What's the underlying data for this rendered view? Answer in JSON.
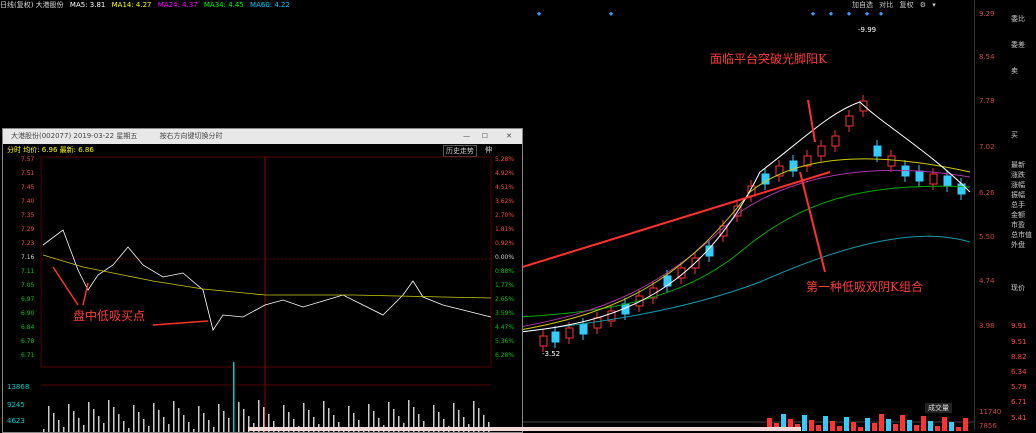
{
  "topbar": {
    "stock": "日线(复权) 大港股份",
    "ma5": "MA5: 3.81",
    "ma14": "MA14: 4.27",
    "ma24": "MA24: 4.37",
    "ma34": "MA34: 4.45",
    "ma60": "MA60: 4.22",
    "actions": [
      "加自选",
      "对比",
      "复权"
    ],
    "icons": [
      "gear-icon",
      "chevron-down-icon"
    ]
  },
  "main_chart": {
    "high_label": "-9.99",
    "low_label": "-3.52",
    "annotation_top": "面临平台突破光脚阳K",
    "annotation_bottom": "第一种低吸双阴K组合",
    "volume_button": "成交量"
  },
  "right_axis": {
    "prices": [
      "9.29",
      "8.54",
      "7.78",
      "7.02",
      "6.26",
      "5.50",
      "4.74",
      "3.98"
    ],
    "volumes": [
      "11740",
      "7856"
    ],
    "side_info": [
      "委比",
      "委差",
      "卖",
      "买",
      "最新",
      "涨跌",
      "涨幅",
      "振幅",
      "总手",
      "金额",
      "市盈",
      "总市值",
      "外盘",
      "现价"
    ],
    "side_values": [
      "9.91",
      "9.51",
      "8.82",
      "6.34",
      "5.79",
      "6.71",
      "5.41"
    ]
  },
  "popup": {
    "title": "大港股份(002077) 2019-03-22 星期五",
    "subtitle": "按右方向键切换分时",
    "info": "分时 均价: 6.96 最新: 6.86",
    "mode_button": "历史走势",
    "expand_button": "伸",
    "left_prices": [
      "7.57",
      "7.51",
      "7.45",
      "7.40",
      "7.35",
      "7.29",
      "7.23",
      "7.16",
      "7.11",
      "7.05",
      "6.97",
      "6.90",
      "6.84",
      "6.78",
      "6.71"
    ],
    "right_pcts": [
      "5.28%",
      "4.92%",
      "4.51%",
      "3.62%",
      "2.70%",
      "1.81%",
      "0.92%",
      "0.00%",
      "0.88%",
      "1.77%",
      "2.65%",
      "3.59%",
      "4.47%",
      "5.36%",
      "6.28%"
    ],
    "volume_labels": [
      "13868",
      "9245",
      "4623"
    ],
    "annotation": "盘中低吸买点"
  }
}
